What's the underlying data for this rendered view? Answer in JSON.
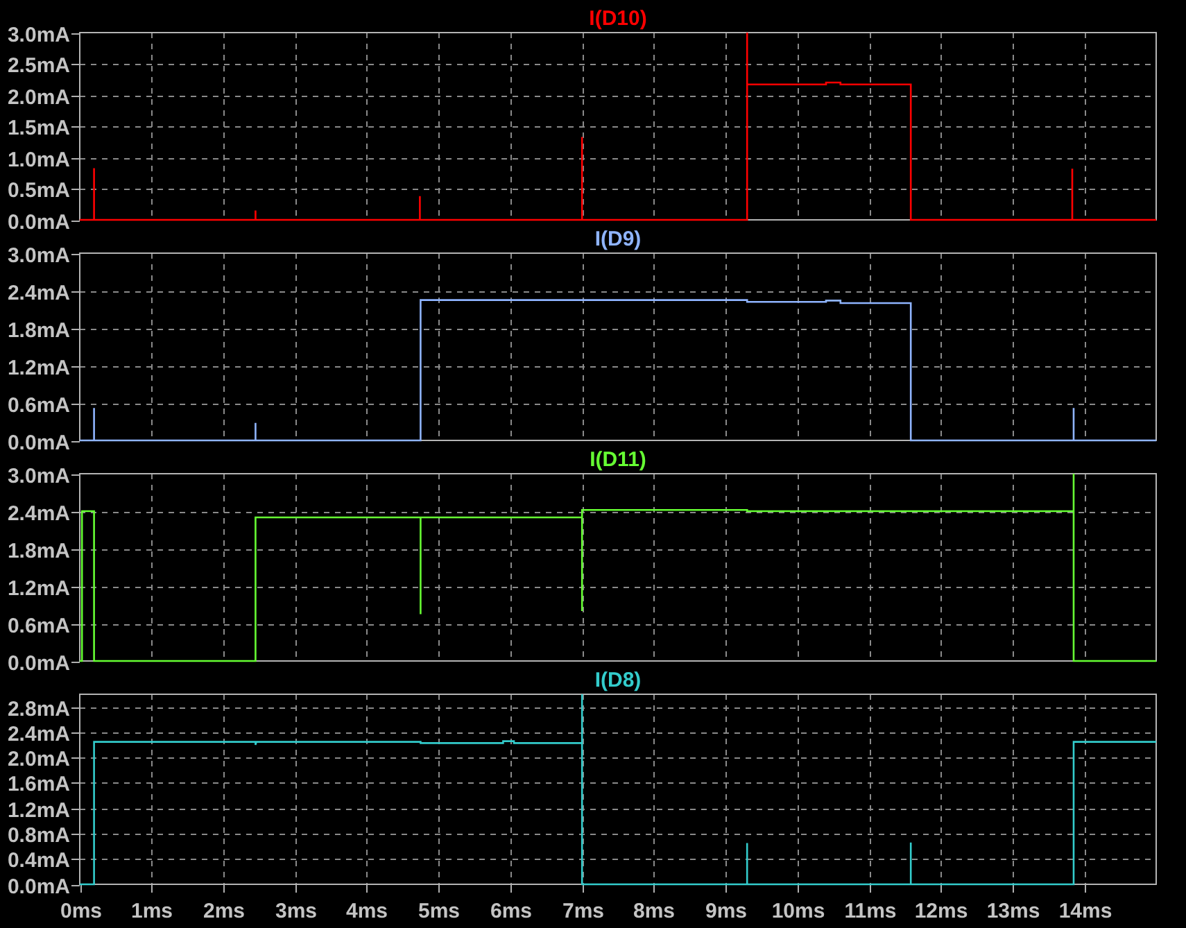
{
  "panes": [
    {
      "chart_data": {
        "type": "line",
        "title": "I(D10)",
        "grid": true,
        "xlim": [
          0,
          15
        ],
        "ylim": [
          0,
          3
        ],
        "x": [
          0,
          0.2,
          0.2,
          0.2,
          2.45,
          2.45,
          2.45,
          4.74,
          4.74,
          4.74,
          7.0,
          7.0,
          7.0,
          9.3,
          9.3,
          9.3,
          10.4,
          10.4,
          10.6,
          10.6,
          11.58,
          11.58,
          13.83,
          13.83,
          13.83,
          15
        ],
        "series": [
          {
            "color": "#ff0000",
            "values": [
              0,
              0,
              0.83,
              0,
              0,
              0.15,
              0,
              0,
              0.38,
              0,
              0,
              1.33,
              0,
              0,
              3.0,
              2.17,
              2.17,
              2.2,
              2.2,
              2.17,
              2.17,
              0,
              0,
              0.82,
              0,
              0
            ]
          }
        ],
        "yticks": [
          {
            "value": 0,
            "label": "0.0mA"
          },
          {
            "value": 0.5,
            "label": "0.5mA"
          },
          {
            "value": 1,
            "label": "1.0mA"
          },
          {
            "value": 1.5,
            "label": "1.5mA"
          },
          {
            "value": 2,
            "label": "2.0mA"
          },
          {
            "value": 2.5,
            "label": "2.5mA"
          },
          {
            "value": 3,
            "label": "3.0mA"
          }
        ]
      }
    },
    {
      "chart_data": {
        "type": "line",
        "title": "I(D9)",
        "grid": true,
        "xlim": [
          0,
          15
        ],
        "ylim": [
          0,
          3
        ],
        "x": [
          0,
          0.2,
          0.2,
          0.2,
          2.45,
          2.45,
          2.45,
          4.75,
          4.75,
          9.3,
          9.3,
          10.4,
          10.4,
          10.6,
          10.6,
          11.58,
          11.58,
          13.85,
          13.85,
          13.85,
          15
        ],
        "series": [
          {
            "color": "#8fb4ff",
            "values": [
              0,
              0,
              0.52,
              0,
              0,
              0.28,
              0,
              0,
              2.25,
              2.25,
              2.22,
              2.22,
              2.24,
              2.24,
              2.2,
              2.2,
              0,
              0,
              0.52,
              0,
              0
            ]
          }
        ],
        "yticks": [
          {
            "value": 0,
            "label": "0.0mA"
          },
          {
            "value": 0.6,
            "label": "0.6mA"
          },
          {
            "value": 1.2,
            "label": "1.2mA"
          },
          {
            "value": 1.8,
            "label": "1.8mA"
          },
          {
            "value": 2.4,
            "label": "2.4mA"
          },
          {
            "value": 3,
            "label": "3.0mA"
          }
        ]
      }
    },
    {
      "chart_data": {
        "type": "line",
        "title": "I(D11)",
        "grid": true,
        "xlim": [
          0,
          15
        ],
        "ylim": [
          0,
          3
        ],
        "x": [
          0,
          0.03,
          0.03,
          0.2,
          0.2,
          2.45,
          2.45,
          4.75,
          4.75,
          4.75,
          7.0,
          7.0,
          7.0,
          9.3,
          9.3,
          13.85,
          13.85,
          13.85,
          15
        ],
        "series": [
          {
            "color": "#66ff33",
            "values": [
              0,
              0,
              2.4,
              2.4,
              0,
              0,
              2.3,
              2.3,
              0.75,
              2.3,
              2.3,
              0.8,
              2.42,
              2.42,
              2.4,
              2.4,
              3.0,
              0,
              0
            ]
          }
        ],
        "yticks": [
          {
            "value": 0,
            "label": "0.0mA"
          },
          {
            "value": 0.6,
            "label": "0.6mA"
          },
          {
            "value": 1.2,
            "label": "1.2mA"
          },
          {
            "value": 1.8,
            "label": "1.8mA"
          },
          {
            "value": 2.4,
            "label": "2.4mA"
          },
          {
            "value": 3,
            "label": "3.0mA"
          }
        ]
      }
    },
    {
      "chart_data": {
        "type": "line",
        "title": "I(D8)",
        "grid": true,
        "xlim": [
          0,
          15
        ],
        "ylim": [
          0,
          3
        ],
        "x": [
          0,
          0.2,
          0.2,
          2.45,
          2.45,
          2.46,
          4.75,
          4.75,
          5.9,
          5.9,
          6.05,
          6.05,
          7.0,
          7.0,
          7.0,
          9.3,
          9.3,
          9.3,
          11.58,
          11.58,
          11.58,
          13.85,
          13.85,
          15
        ],
        "series": [
          {
            "color": "#33cccc",
            "values": [
              0,
              0,
              2.25,
              2.25,
              2.2,
              2.25,
              2.25,
              2.23,
              2.23,
              2.26,
              2.26,
              2.23,
              2.23,
              3.0,
              0,
              0,
              0.65,
              0,
              0,
              0.66,
              0,
              0,
              2.25,
              2.25
            ]
          }
        ],
        "xticks": [
          {
            "value": 0,
            "label": "0ms"
          },
          {
            "value": 1,
            "label": "1ms"
          },
          {
            "value": 2,
            "label": "2ms"
          },
          {
            "value": 3,
            "label": "3ms"
          },
          {
            "value": 4,
            "label": "4ms"
          },
          {
            "value": 5,
            "label": "5ms"
          },
          {
            "value": 6,
            "label": "6ms"
          },
          {
            "value": 7,
            "label": "7ms"
          },
          {
            "value": 8,
            "label": "8ms"
          },
          {
            "value": 9,
            "label": "9ms"
          },
          {
            "value": 10,
            "label": "10ms"
          },
          {
            "value": 11,
            "label": "11ms"
          },
          {
            "value": 12,
            "label": "12ms"
          },
          {
            "value": 13,
            "label": "13ms"
          },
          {
            "value": 14,
            "label": "14ms"
          }
        ],
        "yticks": [
          {
            "value": 0,
            "label": "0.0mA"
          },
          {
            "value": 0.4,
            "label": "0.4mA"
          },
          {
            "value": 0.8,
            "label": "0.8mA"
          },
          {
            "value": 1.2,
            "label": "1.2mA"
          },
          {
            "value": 1.6,
            "label": "1.6mA"
          },
          {
            "value": 2,
            "label": "2.0mA"
          },
          {
            "value": 2.4,
            "label": "2.4mA"
          },
          {
            "value": 2.8,
            "label": "2.8mA"
          }
        ]
      }
    }
  ]
}
